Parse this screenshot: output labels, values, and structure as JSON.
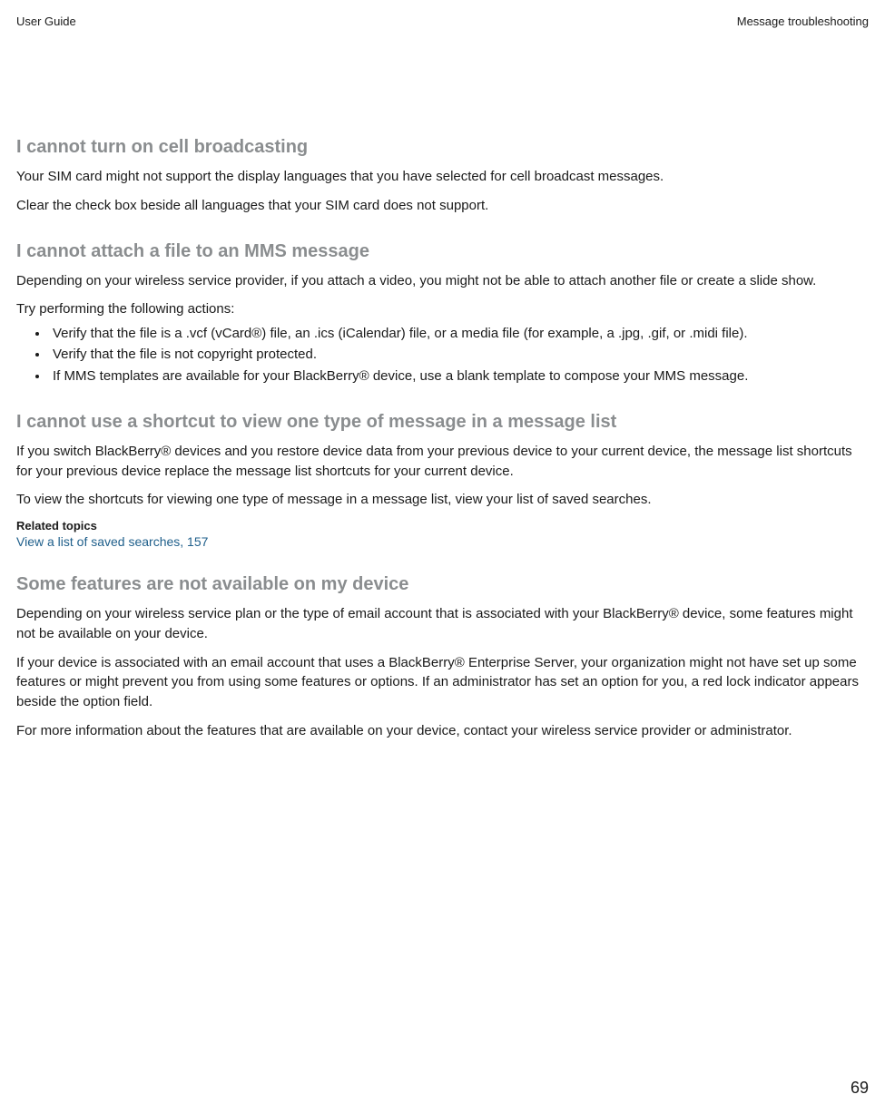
{
  "header": {
    "left": "User Guide",
    "right": "Message troubleshooting"
  },
  "sections": {
    "s1": {
      "heading": "I cannot turn on cell broadcasting",
      "p1": "Your SIM card might not support the display languages that you have selected for cell broadcast messages.",
      "p2": "Clear the check box beside all languages that your SIM card does not support."
    },
    "s2": {
      "heading": "I cannot attach a file to an MMS message",
      "p1": "Depending on your wireless service provider, if you attach a video, you might not be able to attach another file or create a slide show.",
      "p2": "Try performing the following actions:",
      "bullets": {
        "b1": "Verify that the file is a .vcf (vCard®) file, an .ics (iCalendar) file, or a media file (for example, a .jpg, .gif, or .midi file).",
        "b2": "Verify that the file is not copyright protected.",
        "b3": "If MMS templates are available for your BlackBerry® device, use a blank template to compose your MMS message."
      }
    },
    "s3": {
      "heading": "I cannot use a shortcut to view one type of message in a message list",
      "p1": "If you switch BlackBerry® devices and you restore device data from your previous device to your current device, the message list shortcuts for your previous device replace the message list shortcuts for your current device.",
      "p2": "To view the shortcuts for viewing one type of message in a message list, view your list of saved searches.",
      "relatedLabel": "Related topics",
      "relatedLink": "View a list of saved searches, 157"
    },
    "s4": {
      "heading": "Some features are not available on my device",
      "p1": "Depending on your wireless service plan or the type of email account that is associated with your BlackBerry® device, some features might not be available on your device.",
      "p2": "If your device is associated with an email account that uses a BlackBerry® Enterprise Server, your organization might not have set up some features or might prevent you from using some features or options. If an administrator has set an option for you, a red lock indicator appears beside the option field.",
      "p3": "For more information about the features that are available on your device, contact your wireless service provider or administrator."
    }
  },
  "pageNumber": "69"
}
